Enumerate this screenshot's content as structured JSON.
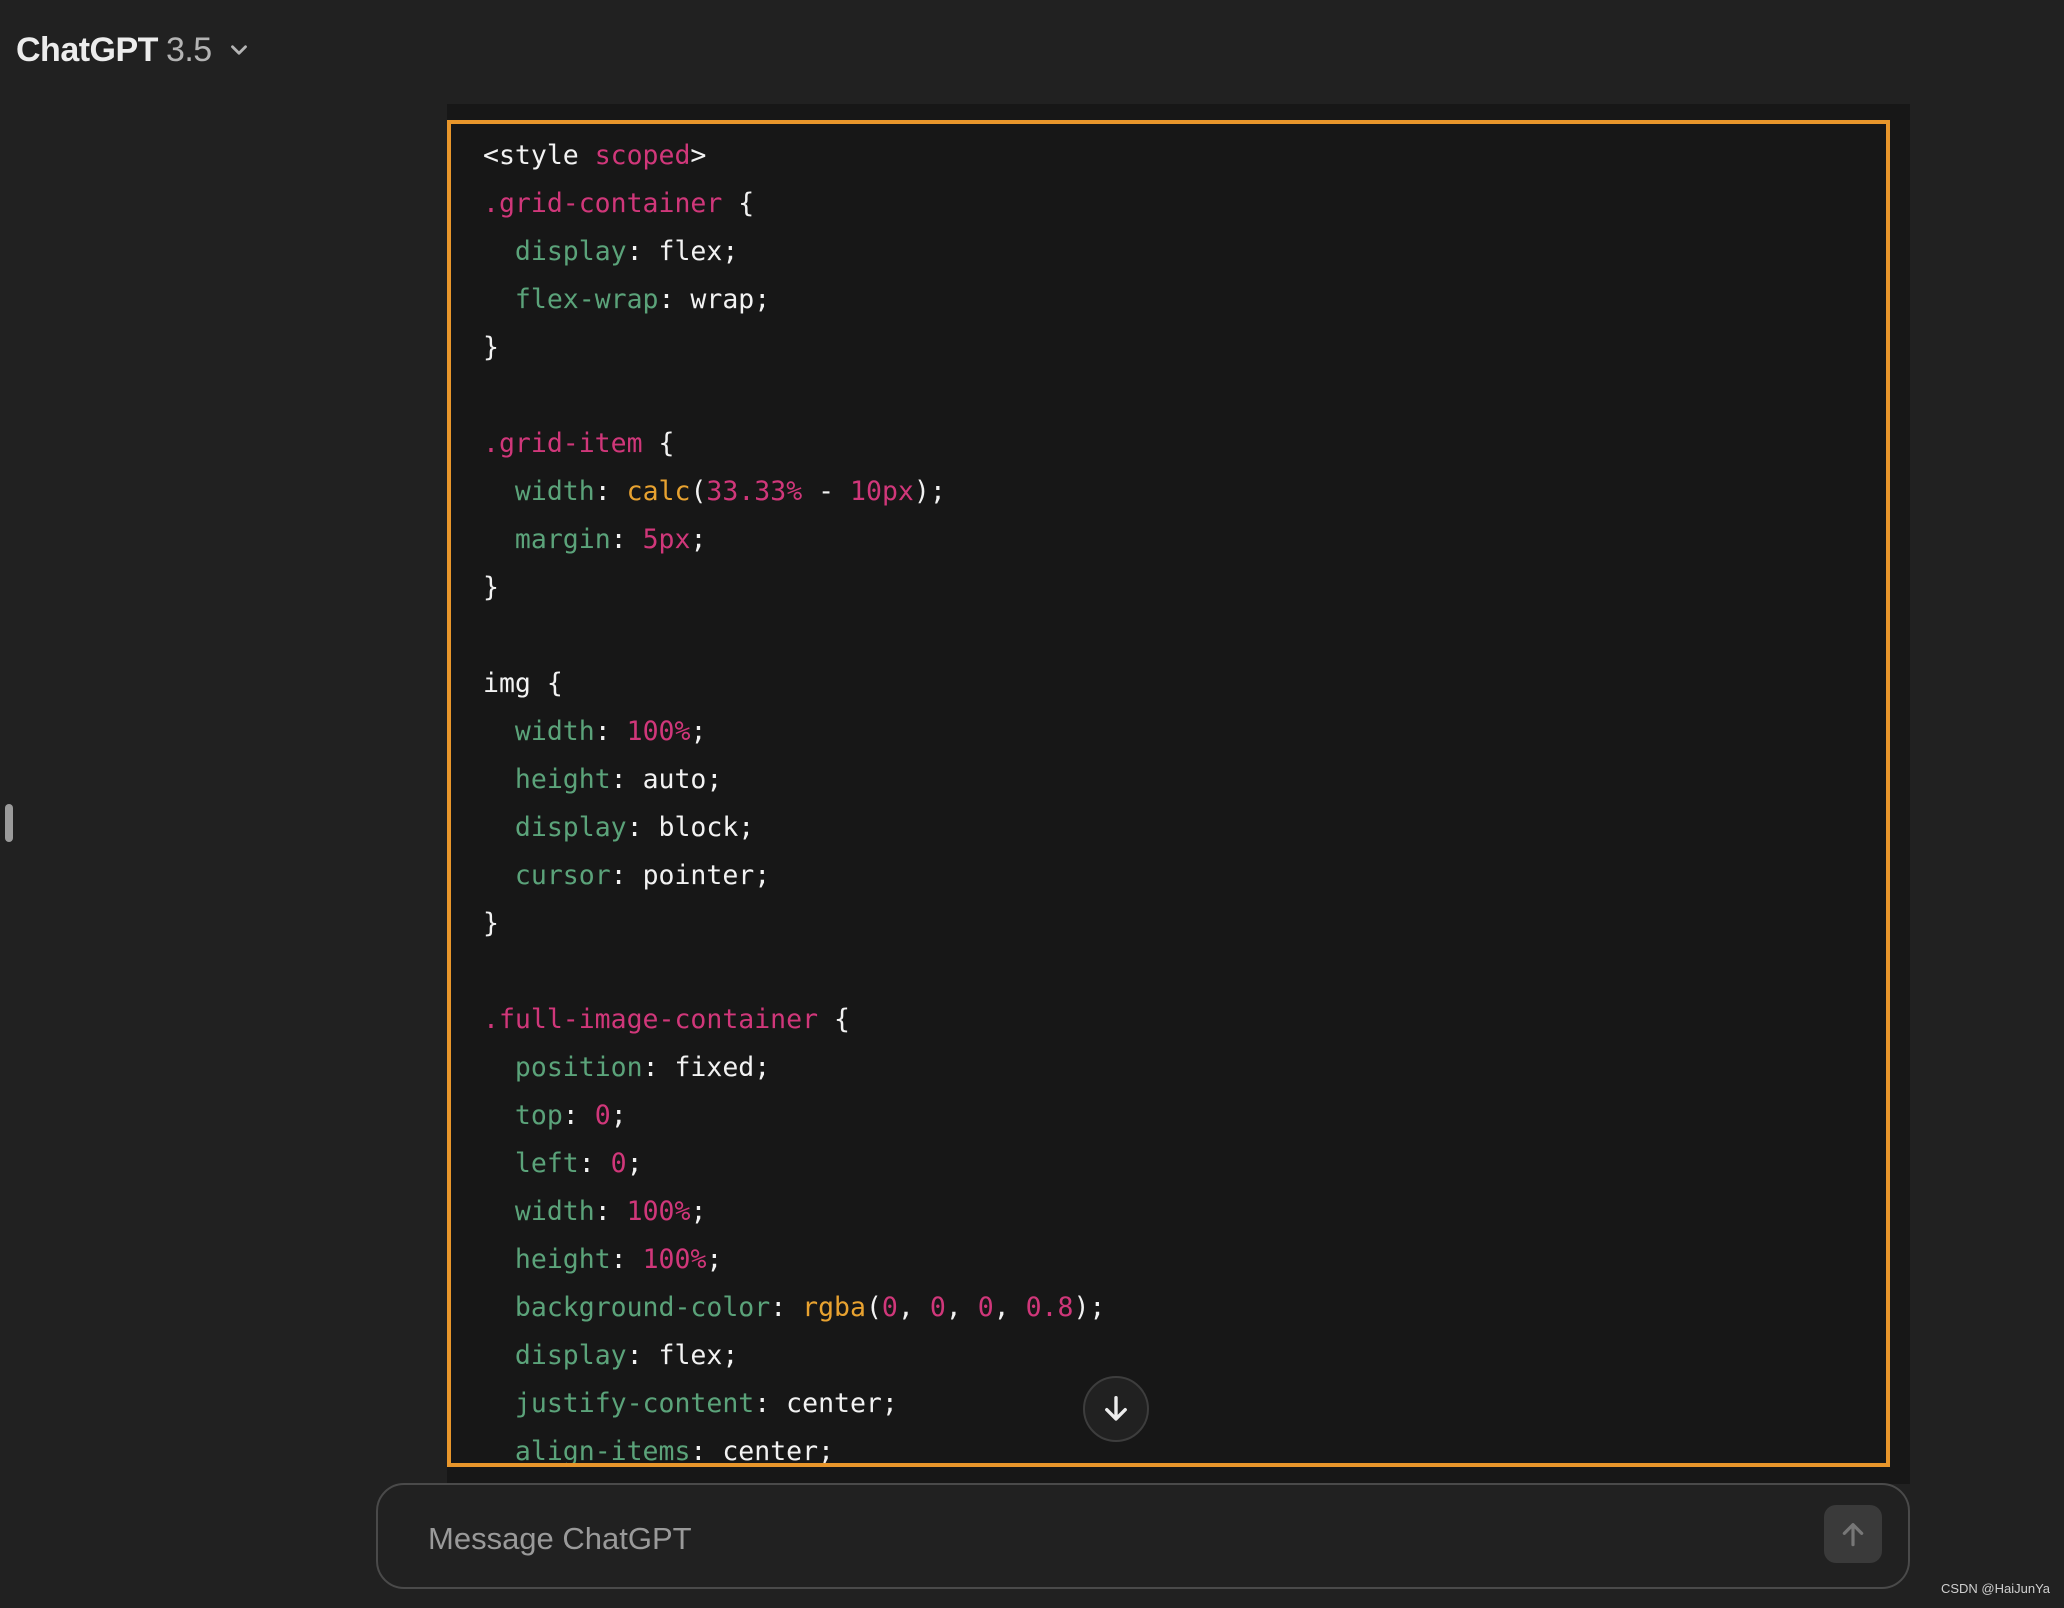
{
  "header": {
    "model_name": "ChatGPT",
    "model_version": "3.5",
    "dropdown_icon": "chevron-down-icon"
  },
  "code_block": {
    "language": "css",
    "lines": [
      [
        [
          "plain",
          "<style "
        ],
        [
          "attr",
          "scoped"
        ],
        [
          "plain",
          ">"
        ]
      ],
      [
        [
          "sel",
          ".grid-container"
        ],
        [
          "plain",
          " {"
        ]
      ],
      [
        [
          "plain",
          "  "
        ],
        [
          "prop",
          "display"
        ],
        [
          "plain",
          ": flex;"
        ]
      ],
      [
        [
          "plain",
          "  "
        ],
        [
          "prop",
          "flex-wrap"
        ],
        [
          "plain",
          ": wrap;"
        ]
      ],
      [
        [
          "plain",
          "}"
        ]
      ],
      [],
      [
        [
          "sel",
          ".grid-item"
        ],
        [
          "plain",
          " {"
        ]
      ],
      [
        [
          "plain",
          "  "
        ],
        [
          "prop",
          "width"
        ],
        [
          "plain",
          ": "
        ],
        [
          "fn",
          "calc"
        ],
        [
          "plain",
          "("
        ],
        [
          "num",
          "33.33%"
        ],
        [
          "plain",
          " - "
        ],
        [
          "num",
          "10px"
        ],
        [
          "plain",
          ");"
        ]
      ],
      [
        [
          "plain",
          "  "
        ],
        [
          "prop",
          "margin"
        ],
        [
          "plain",
          ": "
        ],
        [
          "num",
          "5px"
        ],
        [
          "plain",
          ";"
        ]
      ],
      [
        [
          "plain",
          "}"
        ]
      ],
      [],
      [
        [
          "plain",
          "img {"
        ]
      ],
      [
        [
          "plain",
          "  "
        ],
        [
          "prop",
          "width"
        ],
        [
          "plain",
          ": "
        ],
        [
          "num",
          "100%"
        ],
        [
          "plain",
          ";"
        ]
      ],
      [
        [
          "plain",
          "  "
        ],
        [
          "prop",
          "height"
        ],
        [
          "plain",
          ": auto;"
        ]
      ],
      [
        [
          "plain",
          "  "
        ],
        [
          "prop",
          "display"
        ],
        [
          "plain",
          ": block;"
        ]
      ],
      [
        [
          "plain",
          "  "
        ],
        [
          "prop",
          "cursor"
        ],
        [
          "plain",
          ": pointer;"
        ]
      ],
      [
        [
          "plain",
          "}"
        ]
      ],
      [],
      [
        [
          "sel",
          ".full-image-container"
        ],
        [
          "plain",
          " {"
        ]
      ],
      [
        [
          "plain",
          "  "
        ],
        [
          "prop",
          "position"
        ],
        [
          "plain",
          ": fixed;"
        ]
      ],
      [
        [
          "plain",
          "  "
        ],
        [
          "prop",
          "top"
        ],
        [
          "plain",
          ": "
        ],
        [
          "num",
          "0"
        ],
        [
          "plain",
          ";"
        ]
      ],
      [
        [
          "plain",
          "  "
        ],
        [
          "prop",
          "left"
        ],
        [
          "plain",
          ": "
        ],
        [
          "num",
          "0"
        ],
        [
          "plain",
          ";"
        ]
      ],
      [
        [
          "plain",
          "  "
        ],
        [
          "prop",
          "width"
        ],
        [
          "plain",
          ": "
        ],
        [
          "num",
          "100%"
        ],
        [
          "plain",
          ";"
        ]
      ],
      [
        [
          "plain",
          "  "
        ],
        [
          "prop",
          "height"
        ],
        [
          "plain",
          ": "
        ],
        [
          "num",
          "100%"
        ],
        [
          "plain",
          ";"
        ]
      ],
      [
        [
          "plain",
          "  "
        ],
        [
          "prop",
          "background-color"
        ],
        [
          "plain",
          ": "
        ],
        [
          "fn",
          "rgba"
        ],
        [
          "plain",
          "("
        ],
        [
          "num",
          "0"
        ],
        [
          "plain",
          ", "
        ],
        [
          "num",
          "0"
        ],
        [
          "plain",
          ", "
        ],
        [
          "num",
          "0"
        ],
        [
          "plain",
          ", "
        ],
        [
          "num",
          "0.8"
        ],
        [
          "plain",
          ");"
        ]
      ],
      [
        [
          "plain",
          "  "
        ],
        [
          "prop",
          "display"
        ],
        [
          "plain",
          ": flex;"
        ]
      ],
      [
        [
          "plain",
          "  "
        ],
        [
          "prop",
          "justify-content"
        ],
        [
          "plain",
          ": center;"
        ]
      ],
      [
        [
          "plain",
          "  "
        ],
        [
          "prop",
          "align-items"
        ],
        [
          "plain",
          ": center;"
        ]
      ]
    ]
  },
  "scroll_button": {
    "icon": "arrow-down-icon"
  },
  "composer": {
    "placeholder": "Message ChatGPT",
    "value": "",
    "send_icon": "arrow-up-icon"
  },
  "watermark": "CSDN @HaiJunYa",
  "colors": {
    "highlight_border": "#e8962b",
    "selector": "#d0377a",
    "property": "#5ba37a",
    "function": "#e8a230",
    "number": "#d0377a"
  }
}
